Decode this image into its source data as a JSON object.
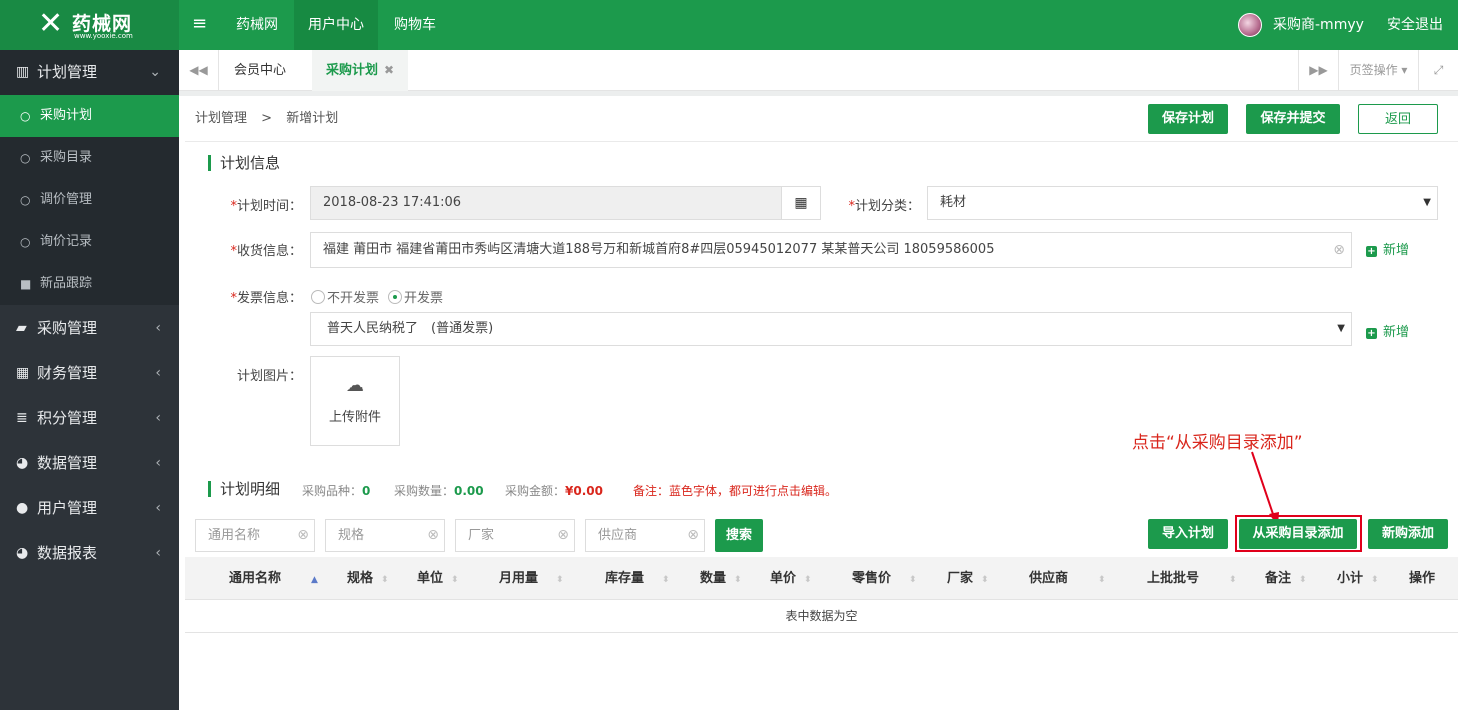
{
  "brand": {
    "name": "药械网",
    "url": "www.yooxie.com"
  },
  "topnav": {
    "items": [
      "药械网",
      "用户中心",
      "购物车"
    ],
    "user": "采购商-mmyy",
    "logout": "安全退出"
  },
  "sidebar": {
    "group_plan": "计划管理",
    "sub": [
      "采购计划",
      "采购目录",
      "调价管理",
      "询价记录",
      "新品跟踪"
    ],
    "groups": [
      "采购管理",
      "财务管理",
      "积分管理",
      "数据管理",
      "用户管理",
      "数据报表"
    ]
  },
  "tabs": {
    "items": [
      "会员中心",
      "采购计划"
    ],
    "tab_ops": "页签操作"
  },
  "breadcrumb": {
    "parent": "计划管理",
    "sep": ">",
    "current": "新增计划"
  },
  "actions": {
    "save": "保存计划",
    "save_submit": "保存并提交",
    "back": "返回"
  },
  "plan_info": {
    "title": "计划信息",
    "time_label": "计划时间：",
    "time_value": "2018-08-23 17:41:06",
    "category_label": "计划分类：",
    "category_value": "耗材",
    "receive_label": "收货信息：",
    "receive_value": "福建 莆田市 福建省莆田市秀屿区清塘大道188号万和新城首府8#四层05945012077 某某普天公司 18059586005",
    "add_label": "新增",
    "invoice_label": "发票信息：",
    "invoice_opt_none": "不开发票",
    "invoice_opt_yes": "开发票",
    "invoice_value": "普天人民纳税了　(普通发票)",
    "image_label": "计划图片：",
    "upload_label": "上传附件"
  },
  "annotation": "点击“从采购目录添加”",
  "detail": {
    "title": "计划明细",
    "stat_kinds_label": "采购品种：",
    "stat_kinds": "0",
    "stat_qty_label": "采购数量：",
    "stat_qty": "0.00",
    "stat_amount_label": "采购金额：",
    "stat_amount": "¥0.00",
    "note": "备注：蓝色字体，都可进行点击编辑。"
  },
  "search": {
    "name_ph": "通用名称",
    "spec_ph": "规格",
    "maker_ph": "厂家",
    "supplier_ph": "供应商",
    "search_btn": "搜索",
    "import_btn": "导入计划",
    "from_catalog_btn": "从采购目录添加",
    "new_btn": "新购添加"
  },
  "table": {
    "columns": [
      "通用名称",
      "规格",
      "单位",
      "月用量",
      "库存量",
      "数量",
      "单价",
      "零售价",
      "厂家",
      "供应商",
      "上批批号",
      "备注",
      "小计",
      "操作"
    ],
    "empty": "表中数据为空"
  },
  "colors": {
    "brand_green": "#1c9a4c",
    "sidebar": "#2d3339",
    "alert_red": "#d9261c"
  }
}
